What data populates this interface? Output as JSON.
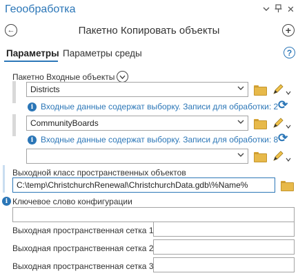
{
  "pane": {
    "title": "Геообработка"
  },
  "header": {
    "pin_icon": "pin-icon",
    "menu_icon": "chevron-down-icon",
    "close_icon": "close-icon"
  },
  "tool": {
    "title": "Пакетно Копировать объекты"
  },
  "tabs": [
    {
      "label": "Параметры",
      "active": true
    },
    {
      "label": "Параметры среды",
      "active": false
    }
  ],
  "batch_input": {
    "label": "Пакетно Входные объекты",
    "rows": [
      {
        "value": "Districts",
        "info": "Входные данные содержат выборку. Записи для обработки: 2"
      },
      {
        "value": "CommunityBoards",
        "info": "Входные данные содержат выборку. Записи для обработки: 8"
      },
      {
        "value": "",
        "info": ""
      }
    ]
  },
  "output_fc": {
    "label": "Выходной класс пространственных объектов",
    "value": "C:\\temp\\ChristchurchRenewal\\ChristchurchData.gdb\\%Name%"
  },
  "config_keyword": {
    "label": "Ключевое слово конфигурации",
    "value": ""
  },
  "grids": [
    {
      "label": "Выходная пространственная сетка 1",
      "value": ""
    },
    {
      "label": "Выходная пространственная сетка 2",
      "value": ""
    },
    {
      "label": "Выходная пространственная сетка 3",
      "value": ""
    }
  ],
  "colors": {
    "accent": "#2b76b7",
    "folder": "#e7b94a"
  }
}
